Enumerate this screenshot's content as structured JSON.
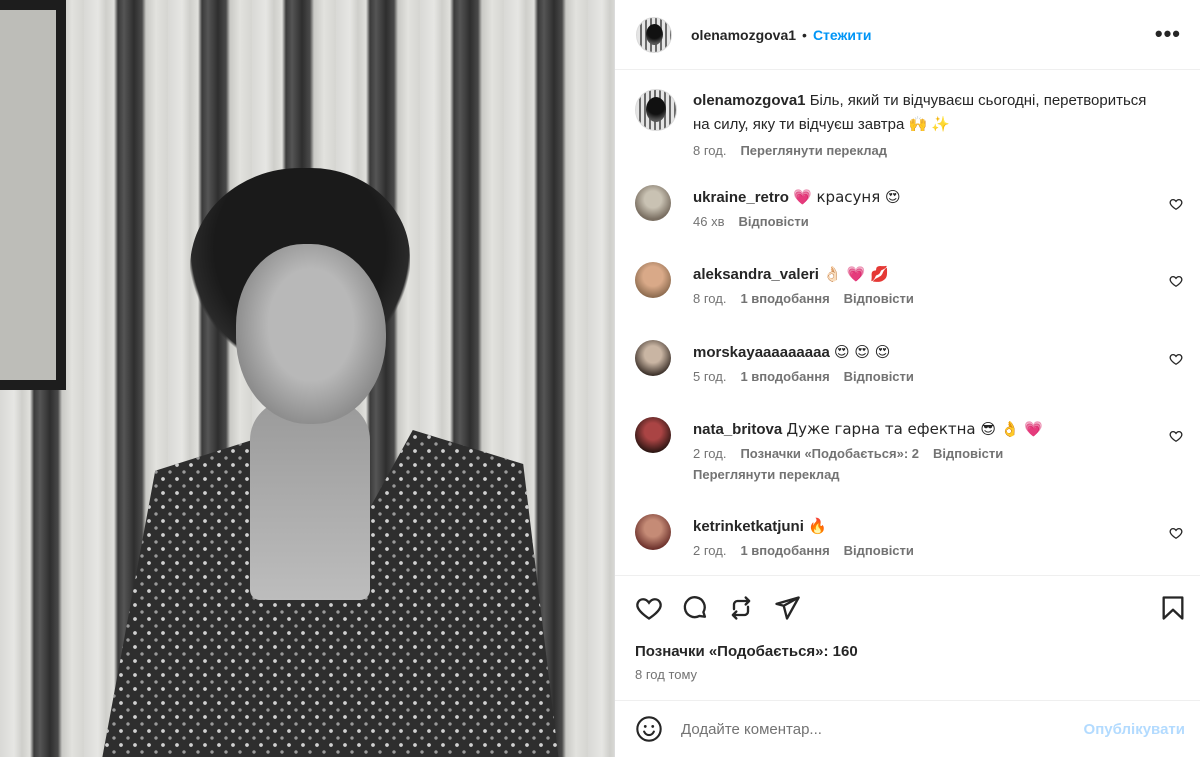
{
  "post": {
    "author": "olenamozgova1",
    "follow_label": "Стежити",
    "more_label": "•••",
    "caption_text": "Біль, який ти відчуваєш сьогодні, перетвориться на силу, яку ти відчуєш завтра 🙌 ✨",
    "caption_time": "8 год.",
    "caption_translate": "Переглянути переклад"
  },
  "comments": [
    {
      "user": "ukraine_retro",
      "text": "💗 красуня 😍",
      "time": "46 хв",
      "likes": "",
      "reply": "Відповісти"
    },
    {
      "user": "aleksandra_valeri",
      "text": "👌🏻 💗 💋",
      "time": "8 год.",
      "likes": "1 вподобання",
      "reply": "Відповісти"
    },
    {
      "user": "morskayaaaaaaaaa",
      "text": "😍 😍 😍",
      "time": "5 год.",
      "likes": "1 вподобання",
      "reply": "Відповісти"
    },
    {
      "user": "nata_britova",
      "text": "Дуже гарна та ефектна 😎 👌 💗",
      "time": "2 год.",
      "likes": "Позначки «Подобається»: 2",
      "reply": "Відповісти",
      "translate": "Переглянути переклад"
    },
    {
      "user": "ketrinketkatjuni",
      "text": "🔥",
      "time": "2 год.",
      "likes": "1 вподобання",
      "reply": "Відповісти"
    }
  ],
  "footer": {
    "likes_text": "Позначки «Подобається»: 160",
    "time_text": "8 год тому",
    "comment_placeholder": "Додайте коментар...",
    "publish_label": "Опублікувати"
  },
  "icons": {
    "like": "heart-icon",
    "comment": "comment-icon",
    "repost": "repost-icon",
    "share": "share-icon",
    "save": "bookmark-icon",
    "emoji": "emoji-icon"
  },
  "colors": {
    "accent": "#0095f6",
    "publish_disabled": "#b3dbff",
    "secondary_text": "#737373",
    "primary_text": "#262626"
  }
}
